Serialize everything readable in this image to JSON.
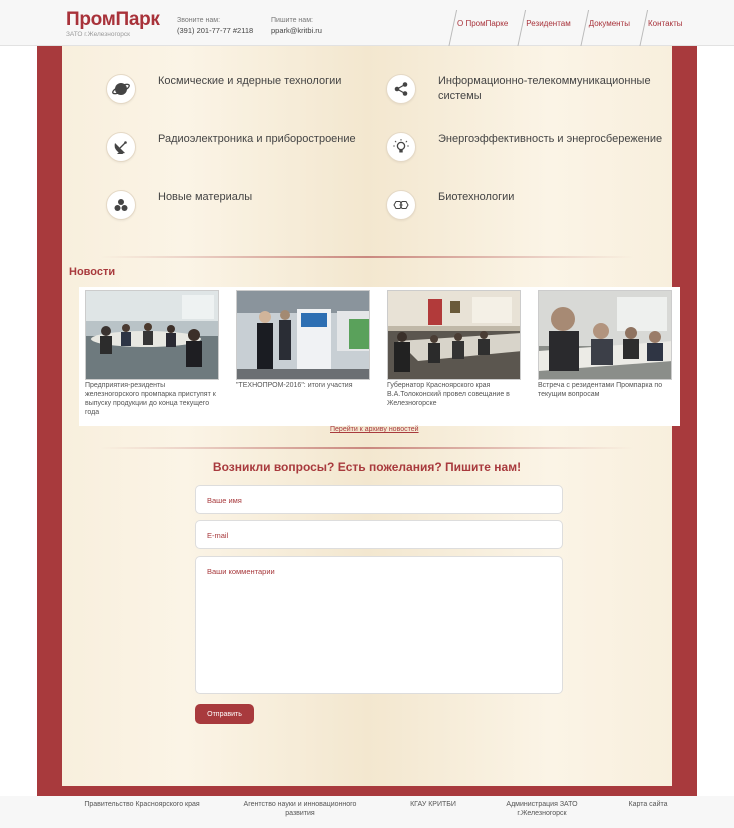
{
  "header": {
    "logo_title": "ПромПарк",
    "logo_subtitle": "ЗАТО г.Железногорск",
    "phone_label": "Звоните нам:",
    "phone_value": "(391) 201-77-77 #2118",
    "email_label": "Пишите нам:",
    "email_value": "ppark@kritbi.ru",
    "nav": [
      "О ПромПарке",
      "Резидентам",
      "Документы",
      "Контакты"
    ]
  },
  "tech": [
    {
      "label": "Космические и ядерные технологии",
      "icon": "planet-icon"
    },
    {
      "label": "Информационно-телекоммуникационные системы",
      "icon": "share-network-icon"
    },
    {
      "label": "Радиоэлектроника и приборостроение",
      "icon": "satellite-dish-icon"
    },
    {
      "label": "Энергоэффективность и энергосбережение",
      "icon": "lightbulb-icon"
    },
    {
      "label": "Новые материалы",
      "icon": "molecule-icon"
    },
    {
      "label": "Биотехнологии",
      "icon": "hexagon-molecule-icon"
    }
  ],
  "news": {
    "title": "Новости",
    "items": [
      {
        "text": "Предприятия-резиденты железногорского промпарка приступят к выпуску продукции до конца текущего года"
      },
      {
        "text": "\"ТЕХНОПРОМ-2016\": итоги участия"
      },
      {
        "text": "Губернатор Красноярского края В.А.Толоконский провел совещание в Железногорске"
      },
      {
        "text": "Встреча с резидентами Промпарка по текущим вопросам"
      }
    ],
    "archive_link": "Перейти к архиву новостей"
  },
  "form": {
    "title": "Возникли вопросы? Есть пожелания? Пишите нам!",
    "name_placeholder": "Ваше имя",
    "email_placeholder": "E-mail",
    "comment_placeholder": "Ваши комментарии",
    "submit_label": "Отправить"
  },
  "footer": {
    "links": [
      "Правительство Красноярского края",
      "Агентство науки и инновационного развития",
      "КГАУ КРИТБИ",
      "Администрация ЗАТО г.Железногорск",
      "Карта сайта"
    ]
  },
  "colors": {
    "accent": "#a83a3d",
    "panel": "#f8efdd"
  }
}
